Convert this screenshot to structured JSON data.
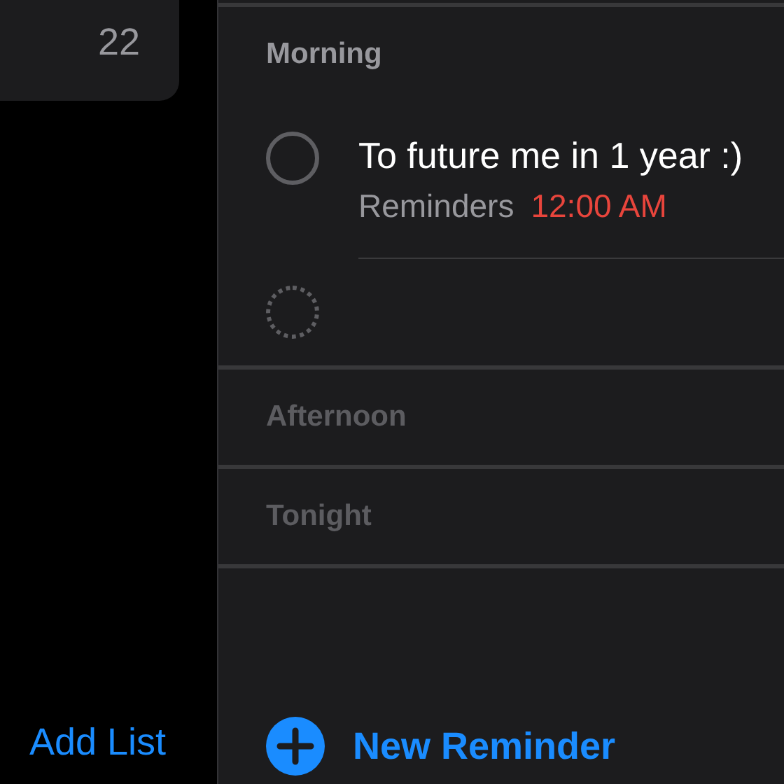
{
  "sidebar": {
    "list_count": "22",
    "add_list": "Add List"
  },
  "sections": [
    {
      "title": "Morning",
      "dimmed": false,
      "reminders": [
        {
          "title": "To future me in 1 year :)",
          "list": "Reminders",
          "time": "12:00 AM",
          "completed": false
        }
      ],
      "new_placeholder": true
    },
    {
      "title": "Afternoon",
      "dimmed": true,
      "new_placeholder": false
    },
    {
      "title": "Tonight",
      "dimmed": true,
      "new_placeholder": false
    }
  ],
  "new_reminder": "New Reminder"
}
